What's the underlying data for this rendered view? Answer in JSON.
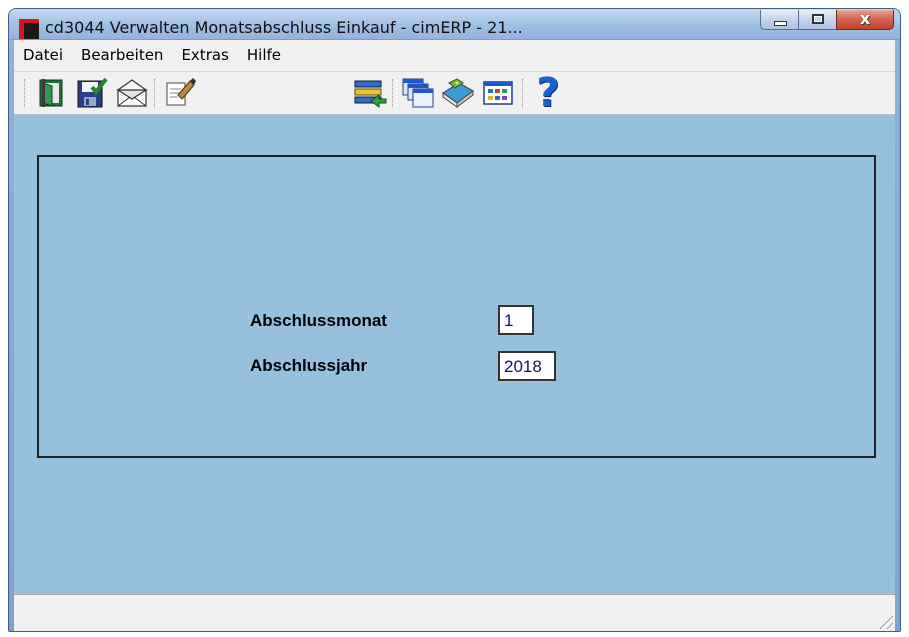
{
  "window": {
    "title": "cd3044 Verwalten Monatsabschluss Einkauf - cimERP - 21...",
    "close_glyph": "x"
  },
  "menu": {
    "items": [
      "Datei",
      "Bearbeiten",
      "Extras",
      "Hilfe"
    ]
  },
  "toolbar": {
    "buttons": [
      "exit-door-icon",
      "save-disk-icon",
      "mail-envelope-icon",
      "document-edit-icon",
      "list-export-icon",
      "windows-cascade-icon",
      "book-tag-icon",
      "grid-table-icon",
      "help-question-icon"
    ],
    "help_glyph": "?"
  },
  "form": {
    "month_label": "Abschlussmonat",
    "month_value": "1",
    "year_label": "Abschlussjahr",
    "year_value": "2018"
  },
  "colors": {
    "form_background": "#96c0dc",
    "chrome": "#f0f0f0",
    "accent_red": "#d7141a"
  }
}
